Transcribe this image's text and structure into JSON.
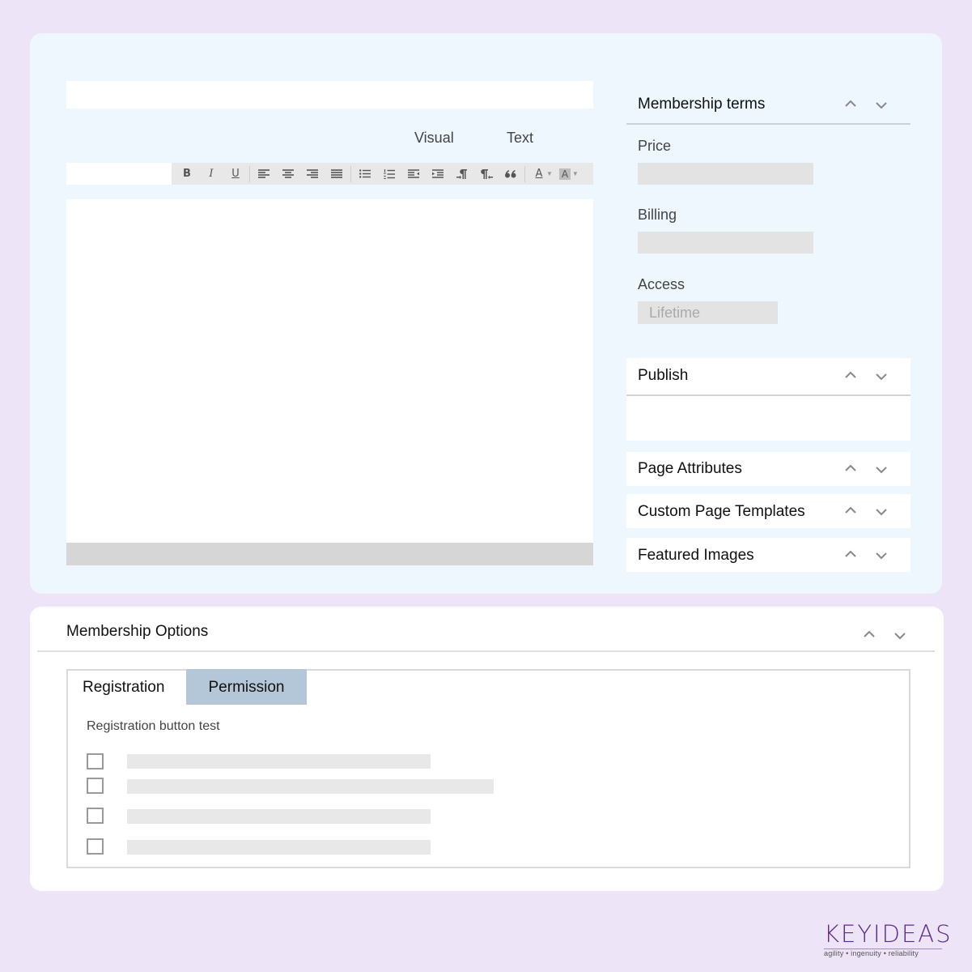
{
  "editor": {
    "title_placeholder": "",
    "tabs": [
      "Visual",
      "Text"
    ],
    "toolbar": {
      "bold": "B",
      "italic": "I",
      "underline": "U",
      "text_color": "A",
      "background_color": "A"
    }
  },
  "sidebar": {
    "membership_terms": {
      "title": "Membership terms",
      "price_label": "Price",
      "billing_label": "Billing",
      "access_label": "Access",
      "access_value": "Lifetime"
    },
    "panels": [
      {
        "title": "Publish"
      },
      {
        "title": "Page Attributes"
      },
      {
        "title": "Custom Page Templates"
      },
      {
        "title": "Featured Images"
      }
    ]
  },
  "membership_options": {
    "title": "Membership Options",
    "tabs": [
      "Registration",
      "Permission"
    ],
    "active_tab": "Permission",
    "registration_label": "Registration button test",
    "checkboxes": [
      false,
      false,
      false,
      false
    ]
  },
  "brand": {
    "logo_text": "KEYIDEAS",
    "tagline": "agility • ingenuity • reliability",
    "logo_color": "#5a2b8a"
  },
  "colors": {
    "page_bg": "#ede4f8",
    "card_bg": "#eef6fe",
    "active_tab": "#b3c7d8"
  }
}
